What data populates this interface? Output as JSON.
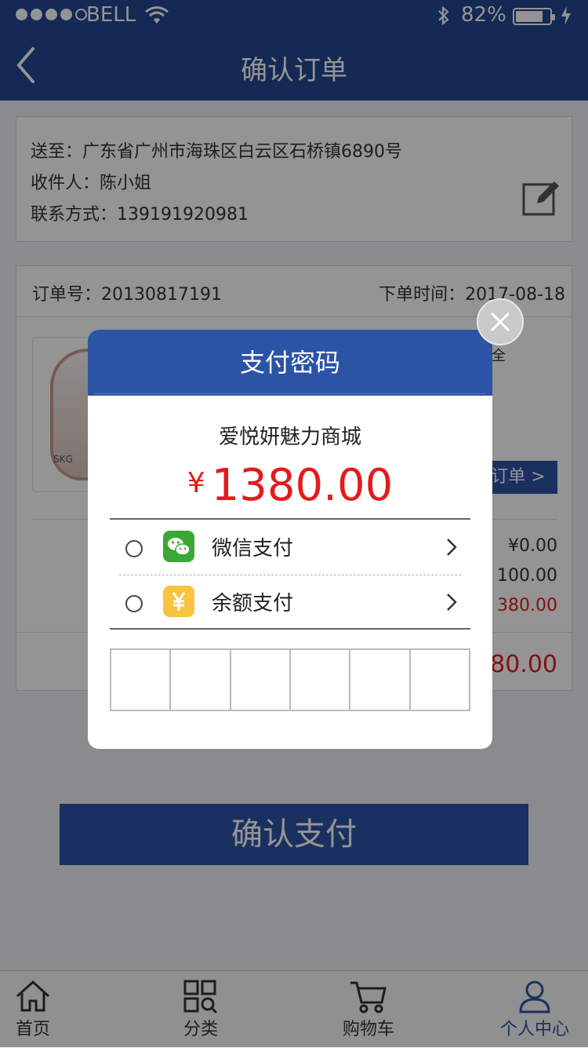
{
  "status_bar": {
    "carrier": "BELL",
    "battery": "82%"
  },
  "header": {
    "title": "确认订单"
  },
  "address": {
    "ship_to": "送至：广东省广州市海珠区白云区石桥镇6890号",
    "recipient": "收件人：陈小姐",
    "contact": "联系方式：139191920981"
  },
  "order": {
    "order_no": "订单号：20130817191",
    "order_time": "下单时间：2017-08-18",
    "thumb_brand": "SKG",
    "view_order_label": "订单 >",
    "peek_fragments": {
      "top_right": "全",
      "fee_1": "¥0.00",
      "fee_2": "100.00",
      "fee_3": "380.00",
      "total": "80.00"
    }
  },
  "confirm_label": "确认支付",
  "tabs": [
    {
      "label": "首页",
      "icon": "home-icon"
    },
    {
      "label": "分类",
      "icon": "category-search-icon"
    },
    {
      "label": "购物车",
      "icon": "cart-icon"
    },
    {
      "label": "个人中心",
      "icon": "user-icon"
    }
  ],
  "modal": {
    "title": "支付密码",
    "merchant": "爱悦妍魅力商城",
    "currency": "¥",
    "amount": "1380.00",
    "methods": [
      {
        "label": "微信支付",
        "icon": "wechat-icon",
        "color": "#3aa834"
      },
      {
        "label": "余额支付",
        "icon": "yen-icon",
        "color": "#f8c440"
      }
    ],
    "password_cells": 6
  },
  "colors": {
    "brand": "#234792",
    "accent": "#2b53a6",
    "price": "#e31b1b"
  }
}
